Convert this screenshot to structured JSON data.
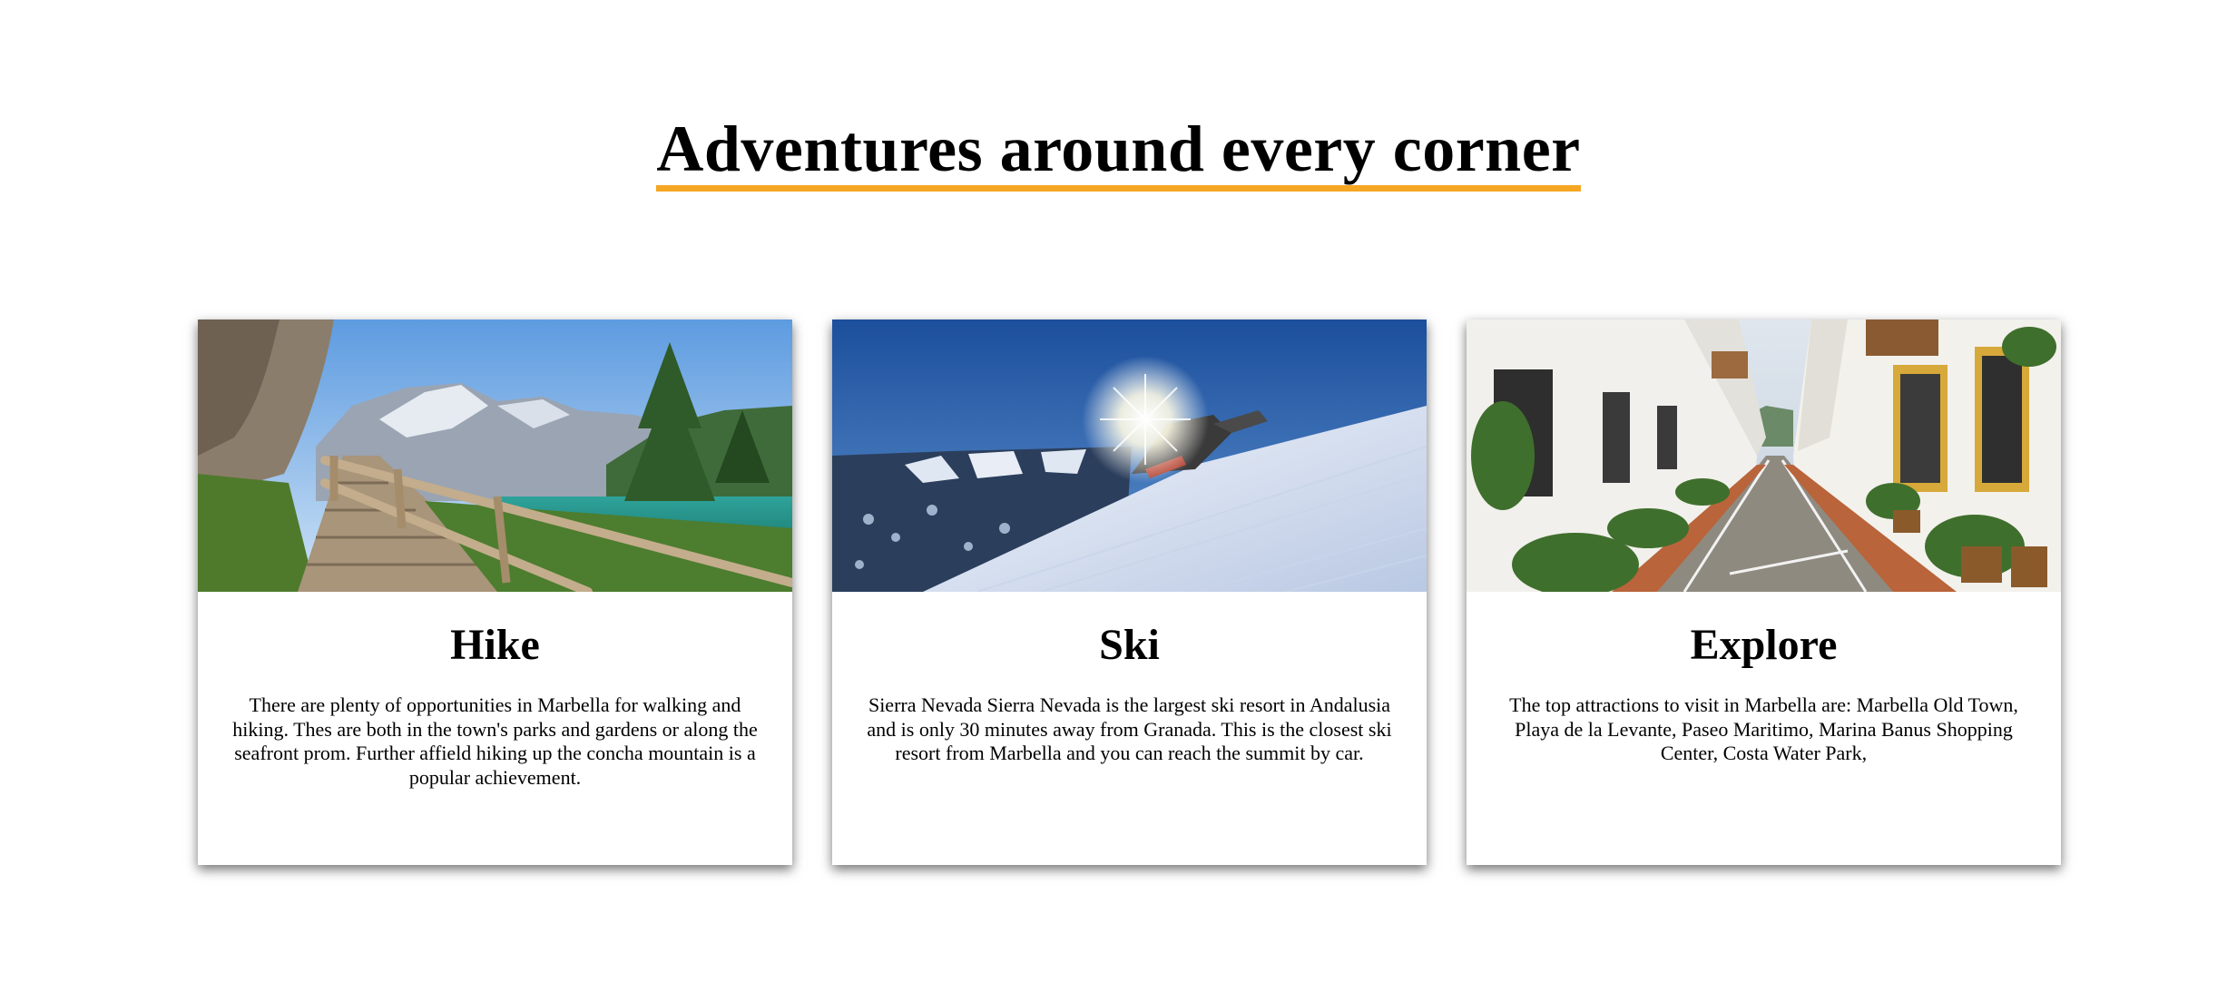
{
  "heading": "Adventures around every corner",
  "colors": {
    "underline": "#f5a623"
  },
  "cards": [
    {
      "title": "Hike",
      "image_subject": "wooden-walkway-mountain-lake",
      "text": "There are plenty of opportunities in Marbella for walking and hiking. Thes are both in the town's parks and gardens or along the seafront prom. Further affield hiking up the concha mountain is a popular achievement."
    },
    {
      "title": "Ski",
      "image_subject": "snow-groomer-ski-slope",
      "text": "Sierra Nevada Sierra Nevada is the largest ski resort in Andalusia and is only 30 minutes away from Granada. This is the closest ski resort from Marbella and you can reach the summit by car."
    },
    {
      "title": "Explore",
      "image_subject": "whitewashed-old-town-street",
      "text": "The top attractions to visit in Marbella are: Marbella Old Town, Playa de la Levante, Paseo Maritimo, Marina Banus Shopping Center, Costa Water Park,"
    }
  ]
}
